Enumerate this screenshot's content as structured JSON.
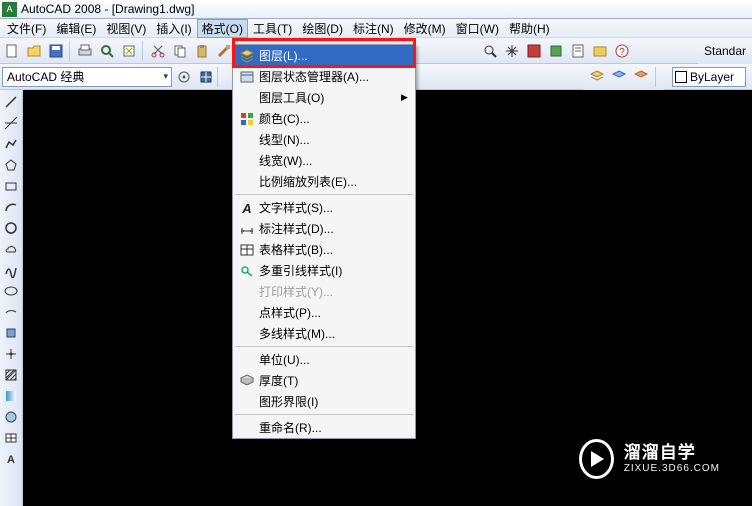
{
  "title": "AutoCAD 2008 - [Drawing1.dwg]",
  "menubar": {
    "items": [
      "文件(F)",
      "编辑(E)",
      "视图(V)",
      "插入(I)",
      "格式(O)",
      "工具(T)",
      "绘图(D)",
      "标注(N)",
      "修改(M)",
      "窗口(W)",
      "帮助(H)"
    ],
    "active_index": 4
  },
  "workspace": {
    "value": "AutoCAD 经典"
  },
  "std_label": "Standar",
  "bylayer": "ByLayer",
  "format_menu": {
    "groups": [
      [
        {
          "label": "图层(L)...",
          "icon": "layers-icon",
          "highlighted": true
        },
        {
          "label": "图层状态管理器(A)...",
          "icon": "layer-state-icon"
        },
        {
          "label": "图层工具(O)",
          "submenu": true
        },
        {
          "label": "颜色(C)...",
          "icon": "color-icon"
        },
        {
          "label": "线型(N)..."
        },
        {
          "label": "线宽(W)..."
        },
        {
          "label": "比例缩放列表(E)..."
        }
      ],
      [
        {
          "label": "文字样式(S)...",
          "icon": "text-style-icon"
        },
        {
          "label": "标注样式(D)...",
          "icon": "dim-style-icon"
        },
        {
          "label": "表格样式(B)...",
          "icon": "table-style-icon"
        },
        {
          "label": "多重引线样式(I)",
          "icon": "mleader-icon"
        },
        {
          "label": "打印样式(Y)...",
          "disabled": true
        },
        {
          "label": "点样式(P)..."
        },
        {
          "label": "多线样式(M)..."
        }
      ],
      [
        {
          "label": "单位(U)..."
        },
        {
          "label": "厚度(T)",
          "icon": "thickness-icon"
        },
        {
          "label": "图形界限(I)"
        }
      ],
      [
        {
          "label": "重命名(R)..."
        }
      ]
    ]
  },
  "left_tools": [
    "line-icon",
    "xline-icon",
    "pline-icon",
    "polygon-icon",
    "rect-icon",
    "arc-icon",
    "circle-icon",
    "revcloud-icon",
    "spline-icon",
    "ellipse-icon",
    "ellipse-arc-icon",
    "block-icon",
    "point-icon",
    "hatch-icon",
    "gradient-icon",
    "region-icon",
    "table-icon",
    "mtext-icon"
  ],
  "layer_strip_icons": [
    "layer-tool-1",
    "layer-tool-2",
    "layer-tool-3"
  ],
  "watermark": {
    "line1": "溜溜自学",
    "line2": "ZIXUE.3D66.COM"
  }
}
